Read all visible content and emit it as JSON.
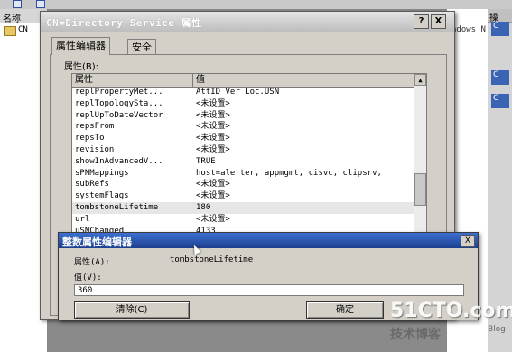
{
  "background": {
    "left_header": "名称",
    "left_item": "CN",
    "mid_text": "adows N",
    "right_header": "操",
    "right_badges": [
      "C",
      "C",
      "C"
    ]
  },
  "dialog": {
    "title": "CN=Directory Service 属性",
    "help_label": "?",
    "close_label": "X",
    "tabs": [
      {
        "label": "属性编辑器",
        "active": true
      },
      {
        "label": "安全",
        "active": false
      }
    ],
    "attributes_label": "属性(B):",
    "columns": [
      "属性",
      "值"
    ],
    "rows": [
      {
        "attr": "replPropertyMet...",
        "value": "AttID  Ver     Loc.USN"
      },
      {
        "attr": "replTopologySta...",
        "value": "<未设置>"
      },
      {
        "attr": "replUpToDateVector",
        "value": "<未设置>"
      },
      {
        "attr": "repsFrom",
        "value": "<未设置>"
      },
      {
        "attr": "repsTo",
        "value": "<未设置>"
      },
      {
        "attr": "revision",
        "value": "<未设置>"
      },
      {
        "attr": "showInAdvancedV...",
        "value": "TRUE"
      },
      {
        "attr": "sPNMappings",
        "value": "host=alerter, appmgmt, cisvc, clipsrv, "
      },
      {
        "attr": "subRefs",
        "value": "<未设置>"
      },
      {
        "attr": "systemFlags",
        "value": "<未设置>"
      },
      {
        "attr": "tombstoneLifetime",
        "value": "180",
        "selected": true
      },
      {
        "attr": "url",
        "value": "<未设置>"
      },
      {
        "attr": "uSNChanged",
        "value": "4133"
      }
    ]
  },
  "editor": {
    "title": "整数属性编辑器",
    "close_label": "X",
    "attribute_label": "属性(A):",
    "attribute_value": "tombstoneLifetime",
    "value_label": "值(V):",
    "value": "360",
    "clear_button": "清除(C)",
    "ok_button": "确定"
  },
  "watermark": {
    "site": "51CTO.com",
    "sub": "技术博客",
    "blog": "Blog"
  },
  "colors": {
    "editor_title": "#2a55b0",
    "selected_row": "#e6e6e6",
    "dialog_face": "#d4d0c8"
  }
}
